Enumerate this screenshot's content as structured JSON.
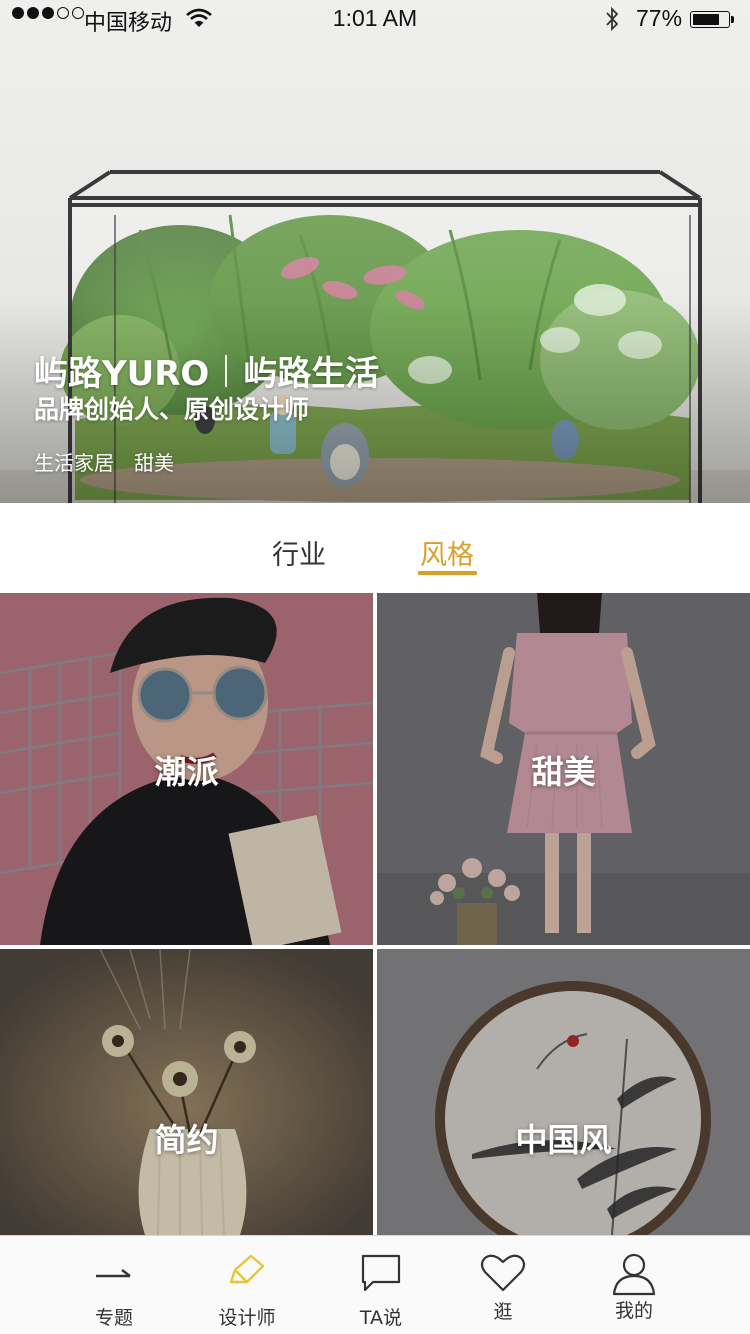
{
  "status_bar": {
    "carrier": "中国移动",
    "time": "1:01 AM",
    "battery": "77%",
    "battery_level": 0.77
  },
  "hero": {
    "brand": "屿路YURO",
    "brand_cn": "屿路生活",
    "subtitle": "品牌创始人、原创设计师",
    "tags": [
      "生活家居",
      "甜美"
    ]
  },
  "tabs": [
    {
      "label": "行业",
      "active": false
    },
    {
      "label": "风格",
      "active": true
    }
  ],
  "styles": [
    {
      "label": "潮派"
    },
    {
      "label": "甜美"
    },
    {
      "label": "简约"
    },
    {
      "label": "中国风"
    }
  ],
  "bottom_nav": [
    {
      "label": "专题",
      "icon": "topic-icon",
      "active": false
    },
    {
      "label": "设计师",
      "icon": "designer-pen-icon",
      "active": true
    },
    {
      "label": "TA说",
      "icon": "chat-bubble-icon",
      "active": false
    },
    {
      "label": "逛",
      "icon": "heart-icon",
      "active": false
    },
    {
      "label": "我的",
      "icon": "user-icon",
      "active": false
    }
  ],
  "colors": {
    "accent": "#dba02a",
    "active_icon": "#e8c43a",
    "text": "#333333"
  }
}
